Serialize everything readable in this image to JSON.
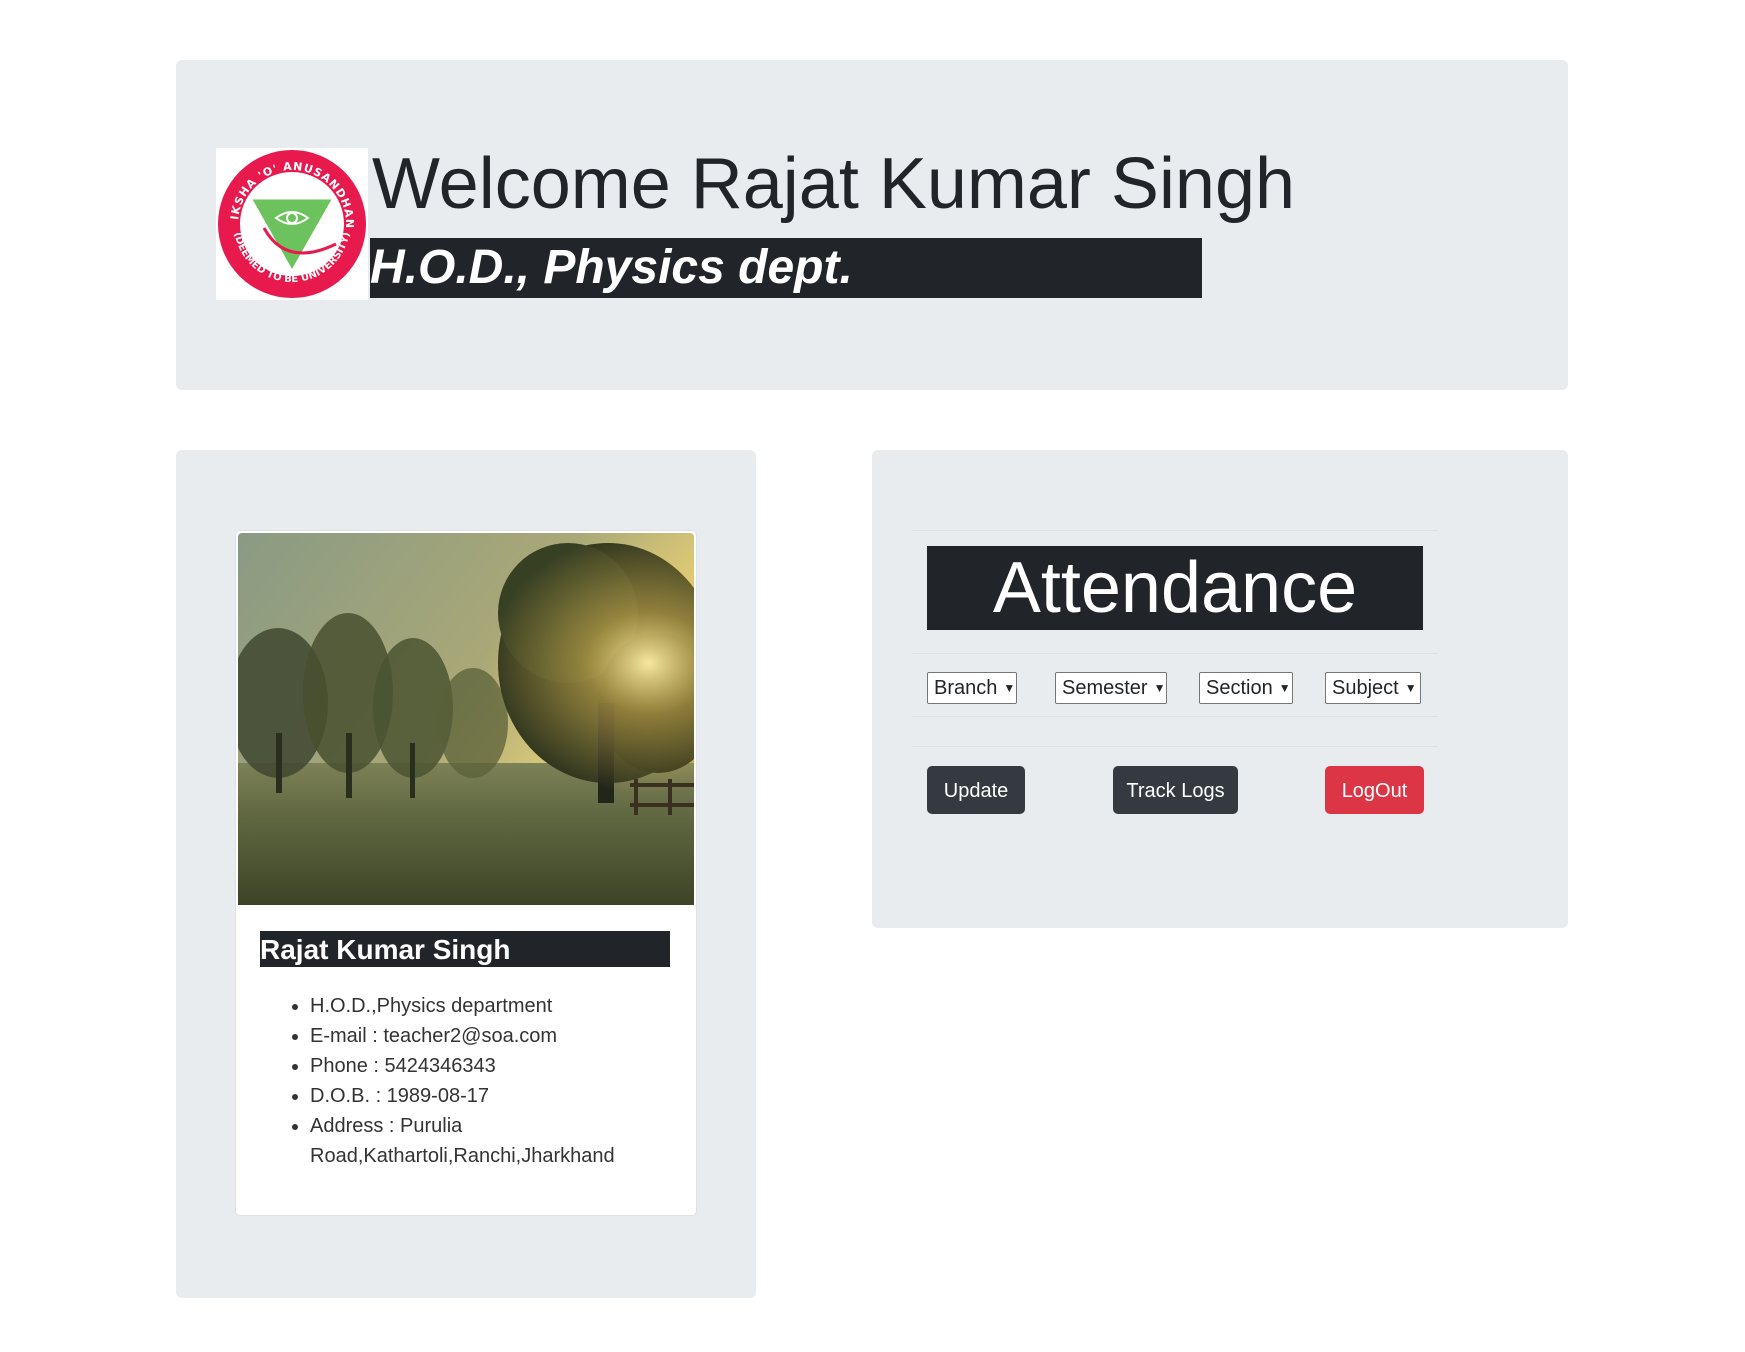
{
  "header": {
    "welcome_text": "Welcome Rajat Kumar Singh",
    "role_text": "H.O.D., Physics dept.",
    "logo": {
      "top_arc_text": "SIKSHA 'O' ANUSANDHAN",
      "bottom_arc_text": "(DEEMED TO BE UNIVERSITY)"
    }
  },
  "profile": {
    "name": "Rajat Kumar Singh",
    "details": [
      "H.O.D.,Physics department",
      "E-mail : teacher2@soa.com",
      "Phone : 5424346343",
      "D.O.B. : 1989-08-17",
      "Address : Purulia Road,Kathartoli,Ranchi,Jharkhand"
    ]
  },
  "attendance": {
    "title": "Attendance",
    "dropdowns": {
      "branch": "Branch",
      "semester": "Semester",
      "section": "Section",
      "subject": "Subject"
    },
    "buttons": {
      "update": "Update",
      "track_logs": "Track Logs",
      "logout": "LogOut"
    }
  },
  "colors": {
    "panel_bg": "#e9ecef",
    "dark": "#212529",
    "button_dark": "#343a40",
    "danger": "#dc3545",
    "logo_red": "#e8194d",
    "logo_green": "#6cc25c"
  }
}
